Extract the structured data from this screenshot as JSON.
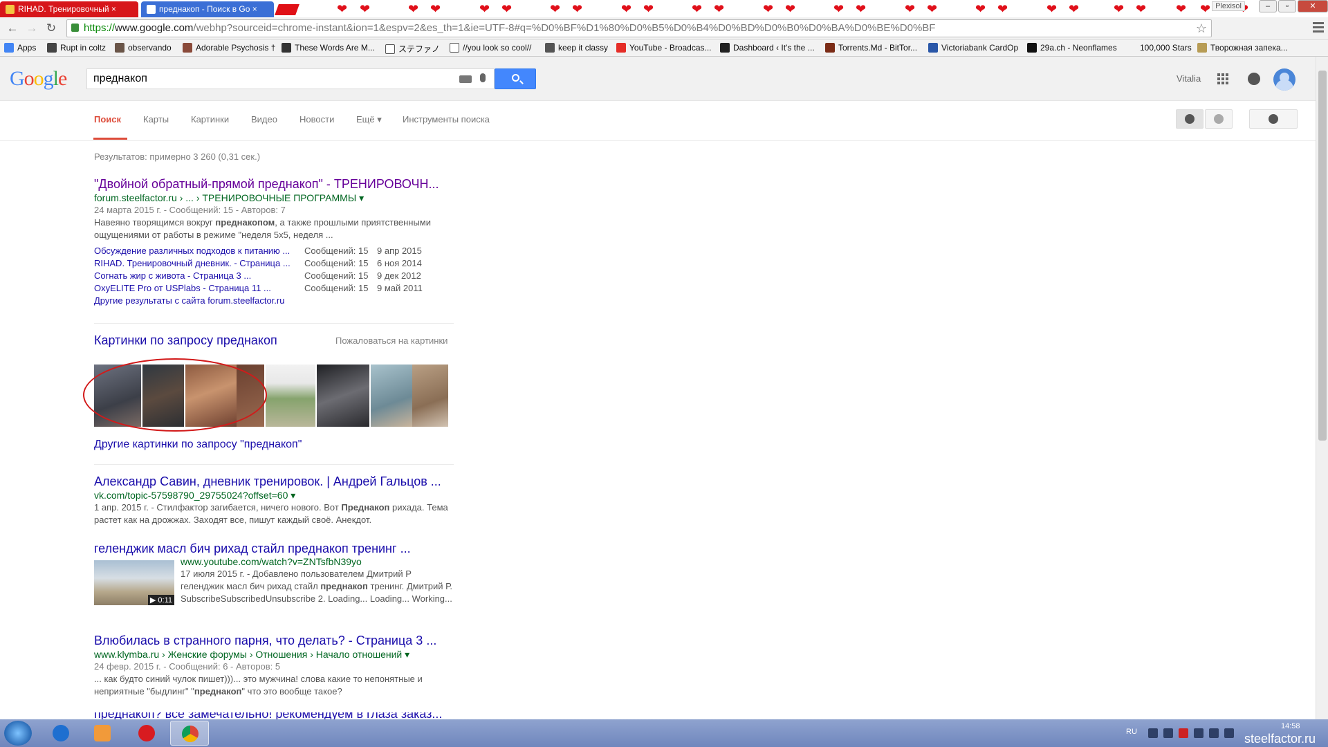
{
  "browser": {
    "tabs": [
      {
        "title": "RIHAD. Тренировочный ×"
      },
      {
        "title": "преднакоп - Поиск в Go ×"
      }
    ],
    "window_label": "Plexisol",
    "url": {
      "scheme": "https://",
      "host": "www.google.com",
      "rest": "/webhp?sourceid=chrome-instant&ion=1&espv=2&es_th=1&ie=UTF-8#q=%D0%BF%D1%80%D0%B5%D0%B4%D0%BD%D0%B0%D0%BA%D0%BE%D0%BF"
    },
    "bookmarks": [
      "Apps",
      "Rupt in coltz",
      "observando",
      "Adorable Psychosis †",
      "These Words Are M...",
      "ステファノ",
      "//you look so cool//",
      "keep it classy",
      "YouTube - Broadcas...",
      "Dashboard ‹ It's the ...",
      "Torrents.Md - BitTor...",
      "Victoriabank CardOp",
      "29a.ch - Neonflames",
      "100,000 Stars",
      "Творожная запека..."
    ]
  },
  "google": {
    "logo": {
      "G": "G",
      "o1": "o",
      "o2": "o",
      "g": "g",
      "l": "l",
      "e": "e"
    },
    "query": "преднакоп",
    "user_name": "Vitalia",
    "nav_tabs": [
      "Поиск",
      "Карты",
      "Картинки",
      "Видео",
      "Новости",
      "Ещё ▾",
      "Инструменты поиска"
    ],
    "stats": "Результатов: примерно 3 260 (0,31 сек.)",
    "result1": {
      "title": "\"Двойной обратный-прямой преднакоп\" - ТРЕНИРОВОЧН...",
      "cite": "forum.steelfactor.ru › ... › ТРЕНИРОВОЧНЫЕ ПРОГРАММЫ ▾",
      "meta": "24 марта 2015 г. - Сообщений: 15 - Авторов: 7",
      "snippet_a": "Навеяно творящимся вокруг ",
      "snippet_b": "преднакопом",
      "snippet_c": ", а также прошлыми приятственными ощущениями от работы в режиме \"неделя 5х5, неделя ...",
      "sitelinks": [
        {
          "title": "Обсуждение различных подходов к питанию ...",
          "count": "Сообщений: 15",
          "date": "9 апр 2015"
        },
        {
          "title": "RIHAD. Тренировочный дневник. - Страница ...",
          "count": "Сообщений: 15",
          "date": "6 ноя 2014"
        },
        {
          "title": "Согнать жир с живота - Страница 3 ...",
          "count": "Сообщений: 15",
          "date": "9 дек 2012"
        },
        {
          "title": "OxyELITE Pro от USPlabs - Страница 11 ...",
          "count": "Сообщений: 15",
          "date": "9 май 2011"
        }
      ],
      "more": "Другие результаты с сайта forum.steelfactor.ru"
    },
    "images": {
      "heading": "Картинки по запросу преднакоп",
      "report": "Пожаловаться на картинки",
      "more": "Другие картинки по запросу \"преднакоп\"",
      "thumb_colors": [
        "#5a5d6a",
        "#3f4a52",
        "#b07a5a",
        "#8b5d44",
        "#8aa173",
        "#3b3d44",
        "#99b3bd",
        "#b69b82"
      ]
    },
    "result2": {
      "title": "Александр Савин, дневник тренировок. | Андрей Гальцов ...",
      "cite": "vk.com/topic-57598790_29755024?offset=60 ▾",
      "snippet_a": "1 апр. 2015 г. - Стилфактор загибается, ничего нового. Вот ",
      "snippet_b": "Преднакоп",
      "snippet_c": " рихада. Тема растет как на дрожжах. Заходят все, пишут каждый своё. Анекдот."
    },
    "result3": {
      "title": "геленджик масл бич рихад стайл преднакоп тренинг ...",
      "cite": "www.youtube.com/watch?v=ZNTsfbN39yo",
      "snippet_a": "17 июля 2015 г. - Добавлено пользователем Дмитрий Р геленджик масл бич рихад стайл ",
      "snippet_b": "преднакоп",
      "snippet_c": " тренинг. Дмитрий Р. SubscribeSubscribedUnsubscribe 2. Loading... Loading... Working...",
      "duration": "▶ 0:11"
    },
    "result4": {
      "title": "Влюбилась в странного парня, что делать? - Страница 3 ...",
      "cite": "www.klymba.ru › Женские форумы › Отношения › Начало отношений ▾",
      "meta": "24 февр. 2015 г. - Сообщений: 6 - Авторов: 5",
      "snippet_a": "... как будто синий чулок пишет)))... это мужчина! слова какие то непонятные и неприятные \"быдлинг\" \"",
      "snippet_b": "преднакоп",
      "snippet_c": "\" что это вообще такое?"
    },
    "result5": {
      "title": "преднакоп? все замечательно! рекомендуем в глаза заказ..."
    }
  },
  "taskbar": {
    "lang": "RU",
    "time": "14:58",
    "watermark": "steelfactor.ru"
  },
  "colors": {
    "link": "#1a0dab",
    "visited": "#660099",
    "cite": "#006621",
    "accent_red": "#dd4b39",
    "search_blue": "#4387fd"
  }
}
